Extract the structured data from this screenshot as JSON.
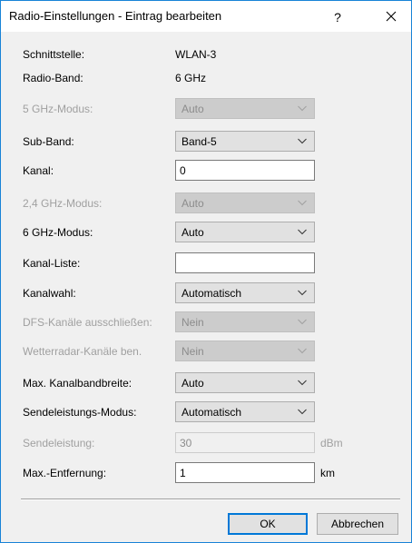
{
  "window": {
    "title": "Radio-Einstellungen - Eintrag bearbeiten",
    "help_label": "?"
  },
  "fields": {
    "schnittstelle": {
      "label": "Schnittstelle:",
      "value": "WLAN-3"
    },
    "radio_band": {
      "label": "Radio-Band:",
      "value": "6 GHz"
    },
    "modus_5ghz": {
      "label": "5 GHz-Modus:",
      "value": "Auto",
      "enabled": false
    },
    "sub_band": {
      "label": "Sub-Band:",
      "value": "Band-5",
      "enabled": true
    },
    "kanal": {
      "label": "Kanal:",
      "value": "0",
      "enabled": true
    },
    "modus_24ghz": {
      "label": "2,4 GHz-Modus:",
      "value": "Auto",
      "enabled": false
    },
    "modus_6ghz": {
      "label": "6 GHz-Modus:",
      "value": "Auto",
      "enabled": true
    },
    "kanal_liste": {
      "label": "Kanal-Liste:",
      "value": "",
      "enabled": true
    },
    "kanalwahl": {
      "label": "Kanalwahl:",
      "value": "Automatisch",
      "enabled": true
    },
    "dfs_ausschliessen": {
      "label": "DFS-Kanäle ausschließen:",
      "value": "Nein",
      "enabled": false
    },
    "wetterradar": {
      "label": "Wetterradar-Kanäle ben.",
      "value": "Nein",
      "enabled": false
    },
    "max_bandbreite": {
      "label": "Max. Kanalbandbreite:",
      "value": "Auto",
      "enabled": true
    },
    "sendeleistungs_modus": {
      "label": "Sendeleistungs-Modus:",
      "value": "Automatisch",
      "enabled": true
    },
    "sendeleistung": {
      "label": "Sendeleistung:",
      "value": "30",
      "unit": "dBm",
      "enabled": false
    },
    "max_entfernung": {
      "label": "Max.-Entfernung:",
      "value": "1",
      "unit": "km",
      "enabled": true
    }
  },
  "buttons": {
    "ok_label": "OK",
    "cancel_label": "Abbrechen"
  },
  "icons": {
    "close": "close-icon",
    "dropdown": "chevron-down-icon"
  }
}
